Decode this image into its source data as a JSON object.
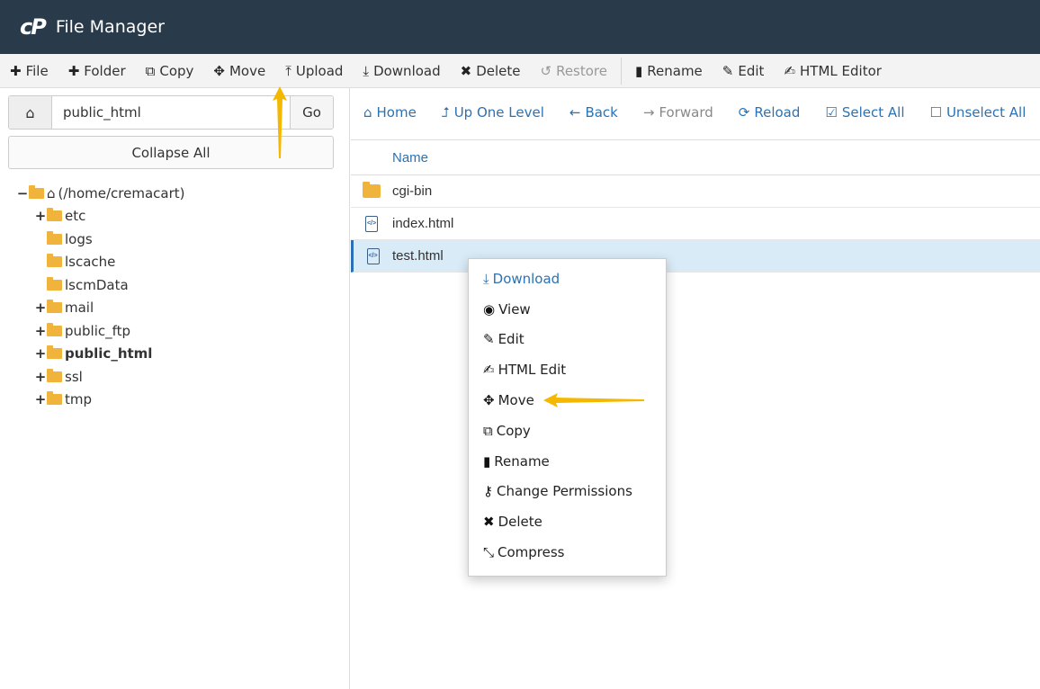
{
  "header": {
    "logo": "cP",
    "title": "File Manager"
  },
  "toolbar": {
    "file": "File",
    "folder": "Folder",
    "copy": "Copy",
    "move": "Move",
    "upload": "Upload",
    "download": "Download",
    "delete": "Delete",
    "restore": "Restore",
    "rename": "Rename",
    "edit": "Edit",
    "html_editor": "HTML Editor"
  },
  "left": {
    "path_value": "public_html",
    "go": "Go",
    "collapse_all": "Collapse All",
    "tree": {
      "root": "(/home/cremacart)",
      "items": [
        "etc",
        "logs",
        "lscache",
        "lscmData",
        "mail",
        "public_ftp",
        "public_html",
        "ssl",
        "tmp"
      ]
    }
  },
  "nav": {
    "home": "Home",
    "up": "Up One Level",
    "back": "Back",
    "forward": "Forward",
    "reload": "Reload",
    "select_all": "Select All",
    "unselect_all": "Unselect All"
  },
  "table": {
    "col_name": "Name",
    "rows": [
      "cgi-bin",
      "index.html",
      "test.html"
    ]
  },
  "context_menu": {
    "items": [
      "Download",
      "View",
      "Edit",
      "HTML Edit",
      "Move",
      "Copy",
      "Rename",
      "Change Permissions",
      "Delete",
      "Compress"
    ]
  },
  "colors": {
    "header_bg": "#293a4a",
    "accent": "#2a72b5",
    "folder": "#f0b43c",
    "arrow": "#f5b800"
  }
}
